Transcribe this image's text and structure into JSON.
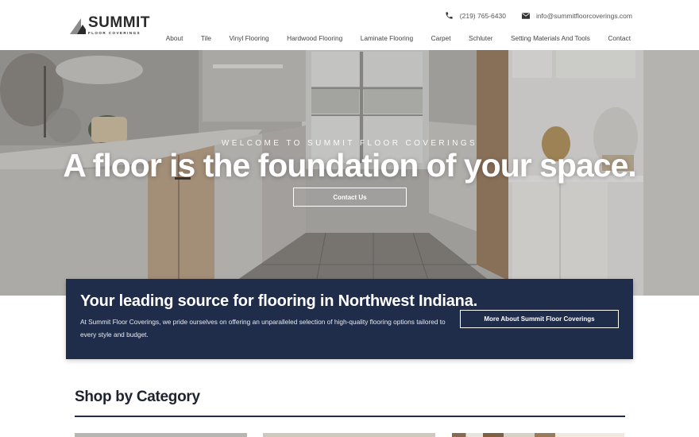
{
  "brand": {
    "name": "SUMMIT",
    "tagline": "FLOOR COVERINGS"
  },
  "contact": {
    "phone": "(219) 765-6430",
    "email": "info@summitfloorcoverings.com"
  },
  "nav": {
    "items": [
      "About",
      "Tile",
      "Vinyl Flooring",
      "Hardwood Flooring",
      "Laminate Flooring",
      "Carpet",
      "Schluter",
      "Setting Materials And Tools",
      "Contact"
    ]
  },
  "hero": {
    "kicker": "WELCOME TO SUMMIT FLOOR COVERINGS",
    "title": "A floor is the foundation of your space.",
    "button": "Contact Us"
  },
  "band": {
    "title": "Your leading source for flooring in Northwest Indiana.",
    "text": "At Summit Floor Coverings, we pride ourselves on offering an unparalleled selection of high-quality flooring options tailored to every style and budget.",
    "button": "More About Summit Floor Coverings",
    "color": "#1f2c4a"
  },
  "shop": {
    "title": "Shop by Category"
  }
}
